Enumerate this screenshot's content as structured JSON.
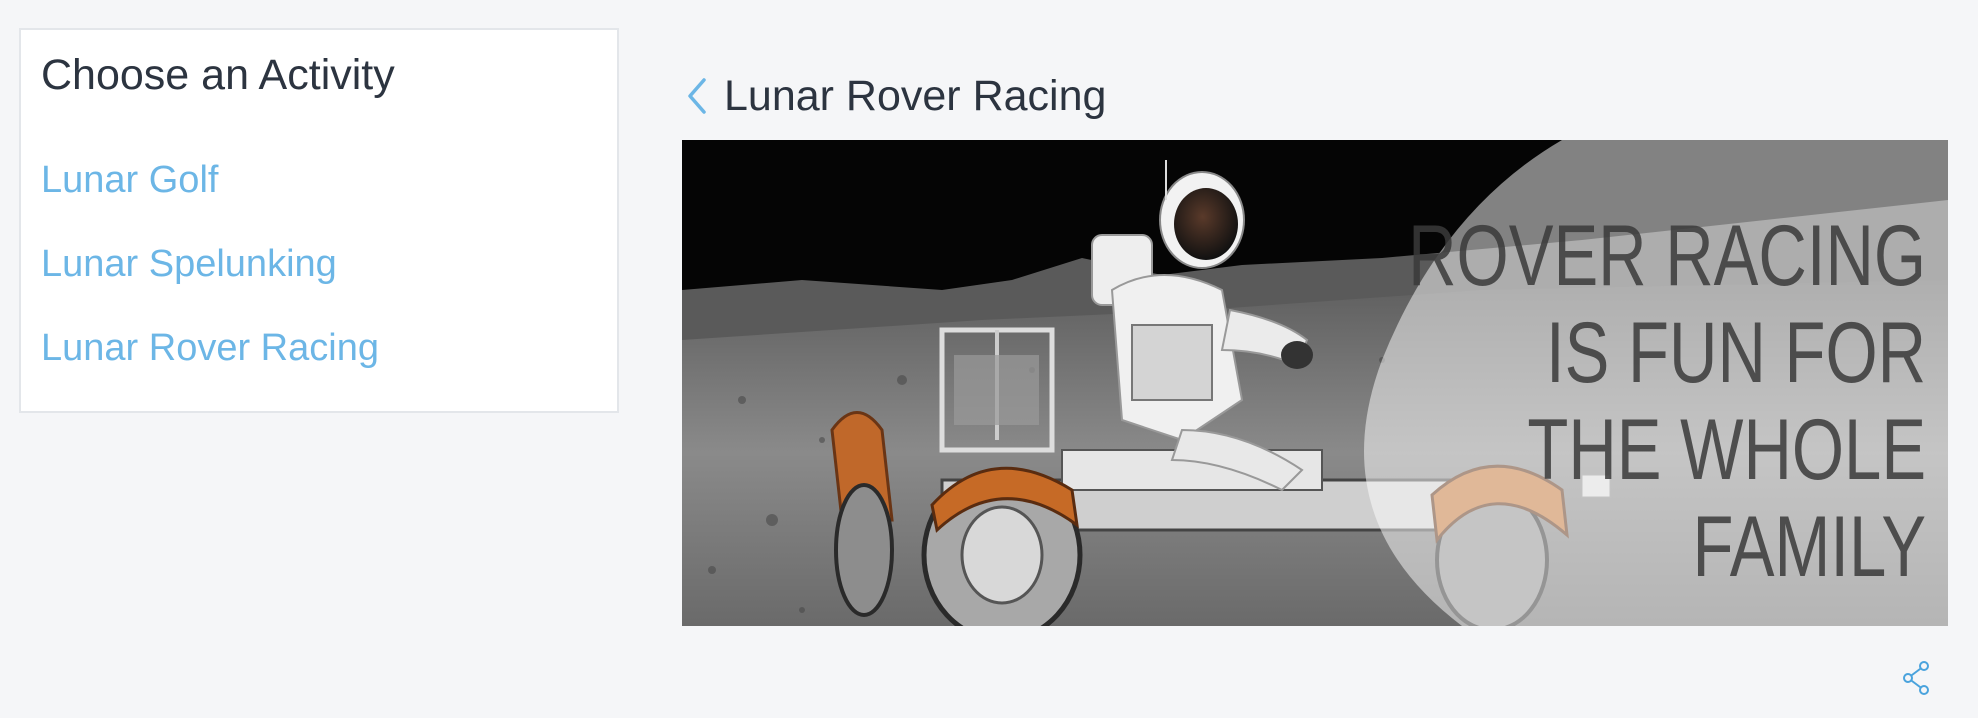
{
  "sidebar": {
    "title": "Choose an Activity",
    "items": [
      {
        "label": "Lunar Golf"
      },
      {
        "label": "Lunar Spelunking"
      },
      {
        "label": "Lunar Rover Racing"
      }
    ]
  },
  "detail": {
    "title": "Lunar Rover Racing",
    "image": {
      "overlay_lines": [
        "ROVER RACING",
        "IS FUN FOR",
        "THE WHOLE",
        "FAMILY"
      ]
    }
  },
  "colors": {
    "link": "#6cb6e6",
    "heading": "#2c3440",
    "background": "#f5f6f8"
  },
  "icons": {
    "back": "chevron-left-icon",
    "share": "share-icon"
  }
}
